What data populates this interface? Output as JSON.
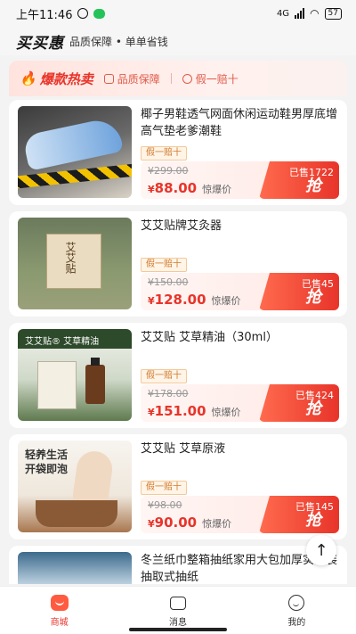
{
  "statusbar": {
    "time": "上午11:46",
    "signal": "4G",
    "battery": "57"
  },
  "brand": {
    "name": "买买惠",
    "slogan": "品质保障 • 单单省钱"
  },
  "hot": {
    "title": "爆款热卖",
    "badges": [
      "品质保障",
      "假一赔十"
    ]
  },
  "products": [
    {
      "title": "椰子男鞋透气网面休闲运动鞋男厚底增高气垫老爹潮鞋",
      "tag": "假一赔十",
      "original_price": "¥299.00",
      "currency": "¥",
      "price": "88.00",
      "price_label": "惊爆价",
      "sold": "已售1722",
      "grab_label": "抢"
    },
    {
      "title": "艾艾贴牌艾灸器",
      "tag": "假一赔十",
      "original_price": "¥150.00",
      "currency": "¥",
      "price": "128.00",
      "price_label": "惊爆价",
      "sold": "已售45",
      "grab_label": "抢"
    },
    {
      "title": "艾艾贴 艾草精油（30ml）",
      "tag": "假一赔十",
      "original_price": "¥178.00",
      "currency": "¥",
      "price": "151.00",
      "price_label": "惊爆价",
      "sold": "已售424",
      "grab_label": "抢"
    },
    {
      "title": "艾艾贴 艾草原液",
      "tag": "假一赔十",
      "original_price": "¥98.00",
      "currency": "¥",
      "price": "90.00",
      "price_label": "惊爆价",
      "sold": "已售145",
      "grab_label": "抢"
    },
    {
      "title": "冬兰纸巾整箱抽纸家用大包加厚实惠装抽取式抽纸"
    }
  ],
  "thumb_text": {
    "p2_box": "艾艾贴",
    "p3_head": "艾艾贴® 艾草精油",
    "p4_line1": "轻养生活",
    "p4_line2": "开袋即泡"
  },
  "tabs": [
    {
      "label": "商城",
      "icon": "shop-icon"
    },
    {
      "label": "消息",
      "icon": "message-icon"
    },
    {
      "label": "我的",
      "icon": "profile-icon"
    }
  ],
  "to_top": "↑",
  "colors": {
    "accent": "#e8342a",
    "tag": "#d07a2e"
  }
}
